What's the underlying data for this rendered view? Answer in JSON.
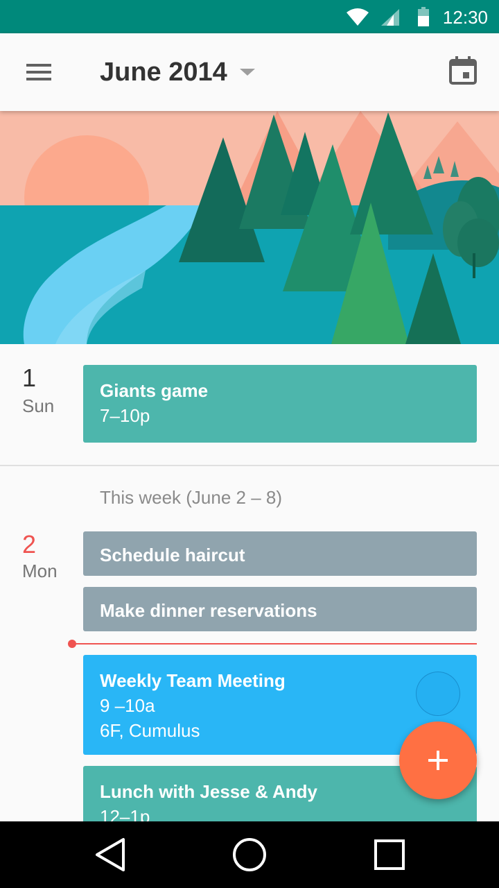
{
  "status_bar": {
    "time": "12:30",
    "icons": [
      "wifi-icon",
      "cell-signal-icon",
      "battery-icon"
    ],
    "color": "#00897b"
  },
  "app_bar": {
    "title": "June 2014",
    "menu_icon": "hamburger-menu-icon",
    "dropdown_icon": "caret-down-icon",
    "today_icon": "calendar-today-icon"
  },
  "agenda": {
    "days": [
      {
        "number": "1",
        "name": "Sun",
        "is_today": false,
        "events": [
          {
            "title": "Giants game",
            "time": "7–10p",
            "location": "",
            "color": "#4db6ac"
          }
        ]
      },
      {
        "number": "2",
        "name": "Mon",
        "is_today": true,
        "events": [
          {
            "title": "Schedule haircut",
            "time": "",
            "location": "",
            "color": "#90a4ae"
          },
          {
            "title": "Make dinner reservations",
            "time": "",
            "location": "",
            "color": "#90a4ae"
          },
          {
            "title": "Weekly Team Meeting",
            "time": "9 –10a",
            "location": "6F, Cumulus",
            "color": "#29b6f6"
          },
          {
            "title": "Lunch with Jesse & Andy",
            "time": "12–1p",
            "location": "",
            "color": "#4db6ac"
          }
        ]
      }
    ],
    "week_label": "This week (June 2 – 8)",
    "today_color": "#ef5350"
  },
  "fab": {
    "icon": "plus-icon",
    "color": "#ff7043"
  },
  "nav_bar": {
    "icons": [
      "back-icon",
      "home-icon",
      "recents-icon"
    ]
  }
}
